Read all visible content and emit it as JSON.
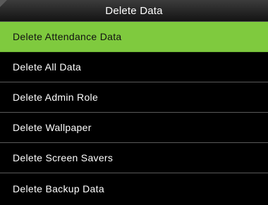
{
  "window": {
    "title": "Delete Data"
  },
  "menu": {
    "selected_index": 0,
    "items": [
      {
        "label": "Delete Attendance Data"
      },
      {
        "label": "Delete All Data"
      },
      {
        "label": "Delete Admin Role"
      },
      {
        "label": "Delete Wallpaper"
      },
      {
        "label": "Delete Screen Savers"
      },
      {
        "label": "Delete Backup Data"
      }
    ]
  },
  "colors": {
    "selected_background": "#7fca3e",
    "background": "#000000",
    "text": "#ffffff"
  }
}
